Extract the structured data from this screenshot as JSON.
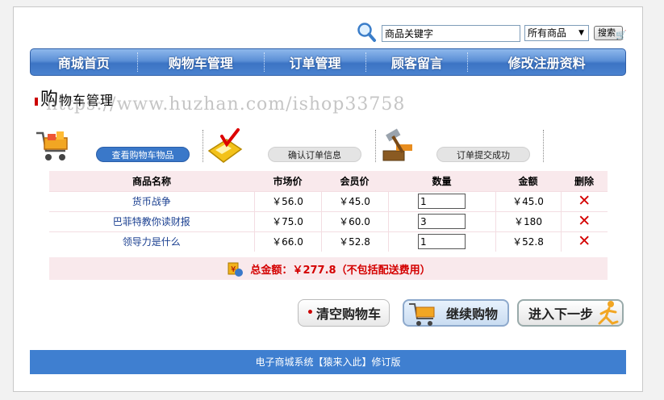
{
  "search": {
    "value": "商品关键字",
    "category": "所有商品",
    "button_label": "搜索"
  },
  "nav": {
    "items": [
      "商城首页",
      "购物车管理",
      "订单管理",
      "顾客留言",
      "修改注册资料"
    ]
  },
  "title": {
    "first_char": "购",
    "rest": "物车管理",
    "watermark": "https://www.huzhan.com/ishop33758"
  },
  "steps": [
    {
      "label": "查看购物车物品",
      "active": true
    },
    {
      "label": "确认订单信息",
      "active": false
    },
    {
      "label": "订单提交成功",
      "active": false
    }
  ],
  "table": {
    "headers": [
      "商品名称",
      "市场价",
      "会员价",
      "数量",
      "金额",
      "删除"
    ],
    "rows": [
      {
        "name": "货币战争",
        "market": "￥56.0",
        "member": "￥45.0",
        "qty": "1",
        "amount": "￥45.0"
      },
      {
        "name": "巴菲特教你读财报",
        "market": "￥75.0",
        "member": "￥60.0",
        "qty": "3",
        "amount": "￥180"
      },
      {
        "name": "领导力是什么",
        "market": "￥66.0",
        "member": "￥52.8",
        "qty": "1",
        "amount": "￥52.8"
      }
    ]
  },
  "total": {
    "label": "总金额：",
    "amount": "￥277.8",
    "note": "（不包括配送费用）"
  },
  "actions": {
    "clear": "清空购物车",
    "continue": "继续购物",
    "next": "进入下一步"
  },
  "footer": {
    "text": "电子商城系统【猿来入此】修订版"
  },
  "colors": {
    "nav": "#4a82cf",
    "footer": "#3f7fd0",
    "accent_red": "#d40000",
    "table_header_bg": "#f9e9ec"
  },
  "icons": {
    "search": "magnifier-icon",
    "cart": "cart-icon",
    "calculator": "calculator-icon",
    "hammer": "hammer-icon",
    "delete": "close-x-icon",
    "money": "money-icon",
    "runner": "runner-icon"
  }
}
